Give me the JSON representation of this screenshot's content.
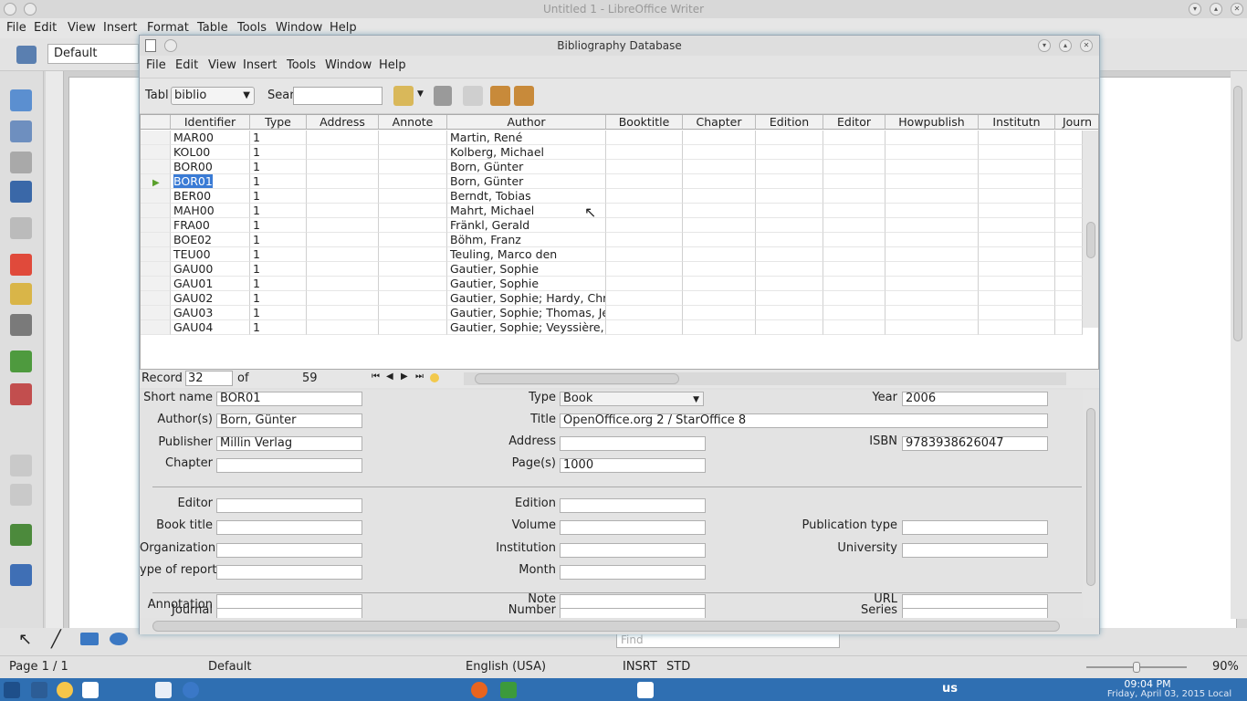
{
  "writer": {
    "title": "Untitled 1 - LibreOffice Writer",
    "menu": [
      "File",
      "Edit",
      "View",
      "Insert",
      "Format",
      "Table",
      "Tools",
      "Window",
      "Help"
    ],
    "style_value": "Default",
    "status": {
      "page": "Page 1 / 1",
      "style": "Default",
      "language": "English (USA)",
      "insert_mode": "INSRT",
      "selection_mode": "STD",
      "zoom": "90%"
    },
    "find_placeholder": "Find"
  },
  "taskbar": {
    "keyboard_layout": "us",
    "time": "09:04 PM",
    "date": "Friday, April 03, 2015 Local"
  },
  "dialog": {
    "title": "Bibliography Database",
    "menu": [
      "File",
      "Edit",
      "View",
      "Insert",
      "Tools",
      "Window",
      "Help"
    ],
    "table_label": "Tabl",
    "table_value": "biblio",
    "search_label": "Sear",
    "search_value": "",
    "columns": [
      "Identifier",
      "Type",
      "Address",
      "Annote",
      "Author",
      "Booktitle",
      "Chapter",
      "Edition",
      "Editor",
      "Howpublish",
      "Institutn",
      "Journ"
    ],
    "rows": [
      {
        "id": "MAR00",
        "type": "1",
        "author": "Martin, René"
      },
      {
        "id": "KOL00",
        "type": "1",
        "author": "Kolberg, Michael"
      },
      {
        "id": "BOR00",
        "type": "1",
        "author": "Born, Günter"
      },
      {
        "id": "BOR01",
        "type": "1",
        "author": "Born, Günter"
      },
      {
        "id": "BER00",
        "type": "1",
        "author": "Berndt, Tobias"
      },
      {
        "id": "MAH00",
        "type": "1",
        "author": "Mahrt, Michael"
      },
      {
        "id": "FRA00",
        "type": "1",
        "author": "Fränkl, Gerald"
      },
      {
        "id": "BOE02",
        "type": "1",
        "author": "Böhm,  Franz"
      },
      {
        "id": "TEU00",
        "type": "1",
        "author": "Teuling, Marco den"
      },
      {
        "id": "GAU00",
        "type": "1",
        "author": "Gautier, Sophie"
      },
      {
        "id": "GAU01",
        "type": "1",
        "author": "Gautier, Sophie"
      },
      {
        "id": "GAU02",
        "type": "1",
        "author": "Gautier, Sophie; Hardy, Chri"
      },
      {
        "id": "GAU03",
        "type": "1",
        "author": "Gautier, Sophie; Thomas, Jea"
      },
      {
        "id": "GAU04",
        "type": "1",
        "author": "Gautier, Sophie; Veyssière, C"
      }
    ],
    "record": {
      "label": "Record",
      "current": "32",
      "of_label": "of",
      "total": "59"
    },
    "form": {
      "short_name": {
        "label": "Short name",
        "value": "BOR01"
      },
      "type": {
        "label": "Type",
        "value": "Book"
      },
      "year": {
        "label": "Year",
        "value": "2006"
      },
      "authors": {
        "label": "Author(s)",
        "value": "Born, Günter"
      },
      "title": {
        "label": "Title",
        "value": "OpenOffice.org 2 / StarOffice 8"
      },
      "publisher": {
        "label": "Publisher",
        "value": "Millin Verlag"
      },
      "address": {
        "label": "Address",
        "value": ""
      },
      "isbn": {
        "label": "ISBN",
        "value": "9783938626047"
      },
      "chapter": {
        "label": "Chapter",
        "value": ""
      },
      "pages": {
        "label": "Page(s)",
        "value": "1000"
      },
      "editor": {
        "label": "Editor",
        "value": ""
      },
      "edition": {
        "label": "Edition",
        "value": ""
      },
      "book_title": {
        "label": "Book title",
        "value": ""
      },
      "volume": {
        "label": "Volume",
        "value": ""
      },
      "publication_type": {
        "label": "Publication type",
        "value": ""
      },
      "organization": {
        "label": "Organization",
        "value": ""
      },
      "institution": {
        "label": "Institution",
        "value": ""
      },
      "university": {
        "label": "University",
        "value": ""
      },
      "type_of_report": {
        "label": "ype of report",
        "value": ""
      },
      "month": {
        "label": "Month",
        "value": ""
      },
      "journal": {
        "label": "Journal",
        "value": ""
      },
      "number": {
        "label": "Number",
        "value": ""
      },
      "series": {
        "label": "Series",
        "value": ""
      },
      "annotation": {
        "label": "Annotation",
        "value": ""
      },
      "note": {
        "label": "Note",
        "value": ""
      },
      "url": {
        "label": "URL",
        "value": ""
      }
    }
  }
}
